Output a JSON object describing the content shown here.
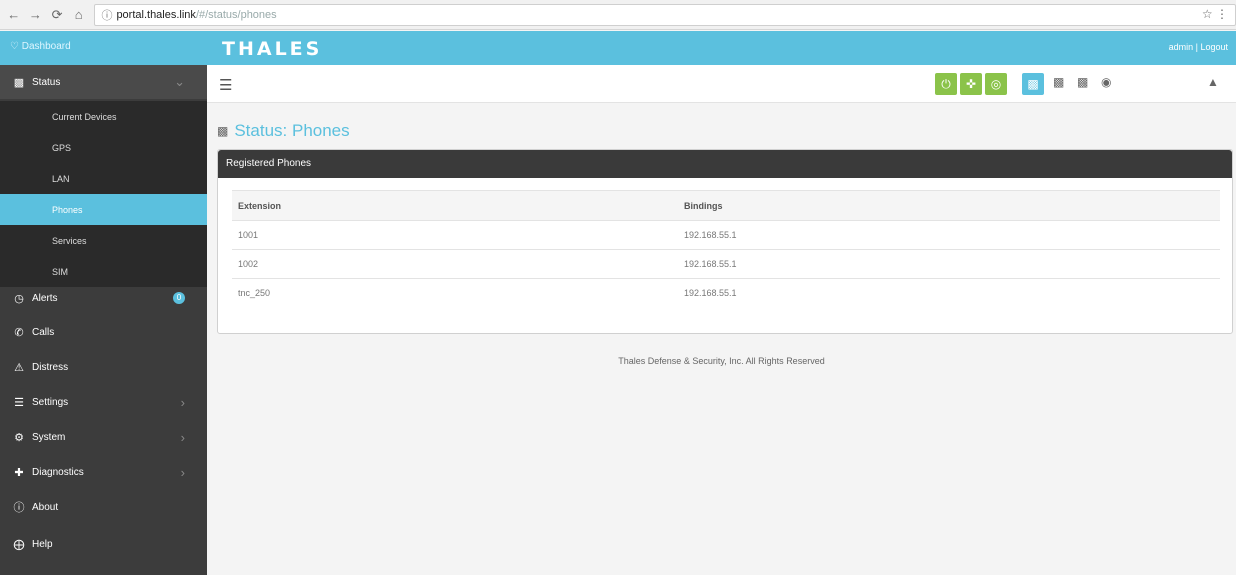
{
  "browser": {
    "url_host": "portal.thales.link",
    "url_path": "/#/status/phones"
  },
  "topbar": {
    "dashboard_label": "Dashboard",
    "logo": "THALES",
    "user_links": "admin | Logout"
  },
  "sidebar": {
    "status": "Status",
    "status_sub": [
      "Current Devices",
      "GPS",
      "LAN",
      "Phones",
      "Services",
      "SIM"
    ],
    "items": [
      {
        "label": "Alerts"
      },
      {
        "label": "Calls"
      },
      {
        "label": "Distress"
      },
      {
        "label": "Settings"
      },
      {
        "label": "System"
      },
      {
        "label": "Diagnostics"
      },
      {
        "label": "About"
      },
      {
        "label": "Help"
      }
    ],
    "alerts_badge": "0"
  },
  "page": {
    "title": "Status: Phones"
  },
  "panel": {
    "title": "Registered Phones",
    "columns": [
      "Extension",
      "Bindings"
    ],
    "rows": [
      [
        "1001",
        "192.168.55.1"
      ],
      [
        "1002",
        "192.168.55.1"
      ],
      [
        "tnc_250",
        "192.168.55.1"
      ]
    ]
  },
  "footer": "Thales Defense & Security, Inc. All Rights Reserved",
  "colors": {
    "accent": "#5bc0de",
    "sidebar": "#3c3c3c",
    "green": "#8bc34a"
  }
}
